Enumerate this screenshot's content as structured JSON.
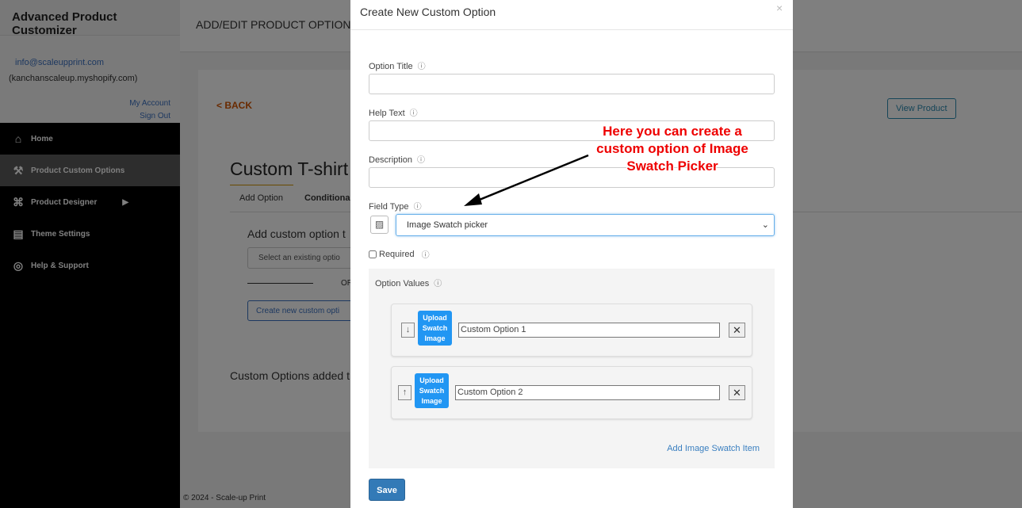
{
  "sidebar": {
    "brand": "Advanced Product Customizer",
    "email": "info@scaleupprint.com",
    "store": "(kanchanscaleup.myshopify.com)",
    "my_account": "My Account",
    "sign_out": "Sign Out",
    "items": [
      {
        "label": "Home",
        "icon": "home-icon"
      },
      {
        "label": "Product Custom Options",
        "icon": "tools-icon"
      },
      {
        "label": "Product Designer",
        "icon": "designer-icon"
      },
      {
        "label": "Theme Settings",
        "icon": "theme-icon"
      },
      {
        "label": "Help & Support",
        "icon": "lifebuoy-icon"
      }
    ]
  },
  "main": {
    "header": "ADD/EDIT PRODUCT OPTIONS",
    "back": "< BACK",
    "view_product": "View Product",
    "product_title": "Custom T-shirt",
    "tabs": [
      "Add Option",
      "Conditional"
    ],
    "add_heading": "Add custom option t",
    "select_placeholder": "Select an existing optio",
    "or": "OR",
    "create_button": "Create new custom opti",
    "added_heading": "Custom Options added t",
    "footer": "© 2024 - Scale-up Print"
  },
  "modal": {
    "title": "Create New Custom Option",
    "close": "×",
    "option_title_label": "Option Title",
    "help_text_label": "Help Text",
    "description_label": "Description",
    "field_type_label": "Field Type",
    "field_type_value": "Image Swatch picker",
    "required_label": "Required",
    "option_values_label": "Option Values",
    "info_icon": "ⓘ",
    "values": [
      {
        "value": "Custom Option 1",
        "move": "↓"
      },
      {
        "value": "Custom Option 2",
        "move": "↑"
      }
    ],
    "upload_label": "Upload Swatch Image",
    "remove": "✕",
    "add_item": "Add Image Swatch Item",
    "save": "Save"
  },
  "annotation": {
    "text": "Here you can create a custom option of Image Swatch Picker"
  },
  "colors": {
    "accent": "#2196f3",
    "save": "#337ab7",
    "back": "#d35400",
    "annotation": "#e00000"
  }
}
